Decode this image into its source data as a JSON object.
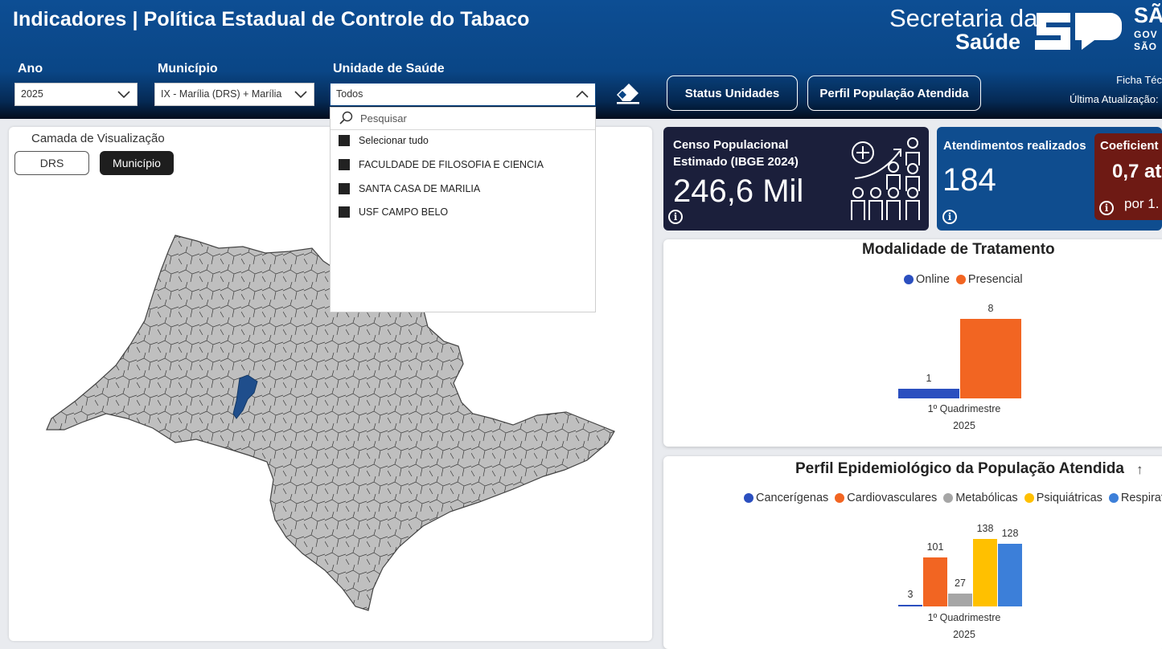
{
  "header": {
    "title": "Indicadores | Política Estadual de Controle do Tabaco",
    "brand_line1": "Secretaria da",
    "brand_line2": "Saúde",
    "brand_sao": "SÃ",
    "brand_gov": "GOV",
    "brand_saop": "SÃO",
    "ficha": "Ficha Téc",
    "ultima_atualizacao": "Última Atualização:"
  },
  "filters": {
    "ano_label": "Ano",
    "ano_value": "2025",
    "municipio_label": "Município",
    "municipio_value": "IX - Marília (DRS) + Marília",
    "unidade_label": "Unidade de Saúde",
    "unidade_value": "Todos"
  },
  "buttons": {
    "status_unidades": "Status Unidades",
    "perfil_populacao": "Perfil População Atendida"
  },
  "dropdown": {
    "search_placeholder": "Pesquisar",
    "options": [
      "Selecionar tudo",
      "FACULDADE DE FILOSOFIA E CIENCIA",
      "SANTA CASA DE MARILIA",
      "USF CAMPO BELO"
    ]
  },
  "map": {
    "camada_label": "Camada de Visualização",
    "layer_options": [
      "DRS",
      "Município"
    ],
    "selected_layer": "Município",
    "highlight_color": "#1f4e8c",
    "fill_color": "#bdbdbd"
  },
  "kpis": {
    "censo": {
      "label_line1": "Censo Populacional",
      "label_line2": "Estimado (IBGE 2024)",
      "value": "246,6 Mil"
    },
    "atendimentos": {
      "label": "Atendimentos realizados",
      "value": "184"
    },
    "coeficiente": {
      "label": "Coeficient",
      "value": "0,7 at",
      "sub": "por 1."
    }
  },
  "chart_data": [
    {
      "type": "bar",
      "title": "Modalidade de Tratamento",
      "categories": [
        "1º Quadrimestre 2025"
      ],
      "series": [
        {
          "name": "Online",
          "values": [
            1
          ],
          "color": "#2b4fbf"
        },
        {
          "name": "Presencial",
          "values": [
            8
          ],
          "color": "#f26522"
        }
      ],
      "ylim": [
        0,
        8
      ]
    },
    {
      "type": "bar",
      "title": "Perfil Epidemiológico da População Atendida",
      "categories": [
        "1º Quadrimestre 2025"
      ],
      "series": [
        {
          "name": "Cancerígenas",
          "values": [
            3
          ],
          "color": "#2b4fbf"
        },
        {
          "name": "Cardiovasculares",
          "values": [
            101
          ],
          "color": "#f26522"
        },
        {
          "name": "Metabólicas",
          "values": [
            27
          ],
          "color": "#a6a6a6"
        },
        {
          "name": "Psiquiátricas",
          "values": [
            138
          ],
          "color": "#ffc000"
        },
        {
          "name": "Respiratórias",
          "values": [
            128
          ],
          "color": "#3c7fd9"
        }
      ],
      "legend_visible": [
        "Cancerígenas",
        "Cardiovasculares",
        "Metabólicas",
        "Psiquiátricas",
        "Respirató"
      ],
      "ylim": [
        0,
        138
      ]
    }
  ],
  "chart_text": {
    "modalidade": {
      "title": "Modalidade de Tratamento",
      "legend": [
        "Online",
        "Presencial"
      ],
      "x_line1": "1º Quadrimestre",
      "x_line2": "2025"
    },
    "perfil": {
      "title": "Perfil Epidemiológico da População Atendida",
      "sort_icon": "↑",
      "legend": [
        "Cancerígenas",
        "Cardiovasculares",
        "Metabólicas",
        "Psiquiátricas",
        "Respirató"
      ],
      "x_line1": "1º Quadrimestre",
      "x_line2": "2025"
    }
  }
}
